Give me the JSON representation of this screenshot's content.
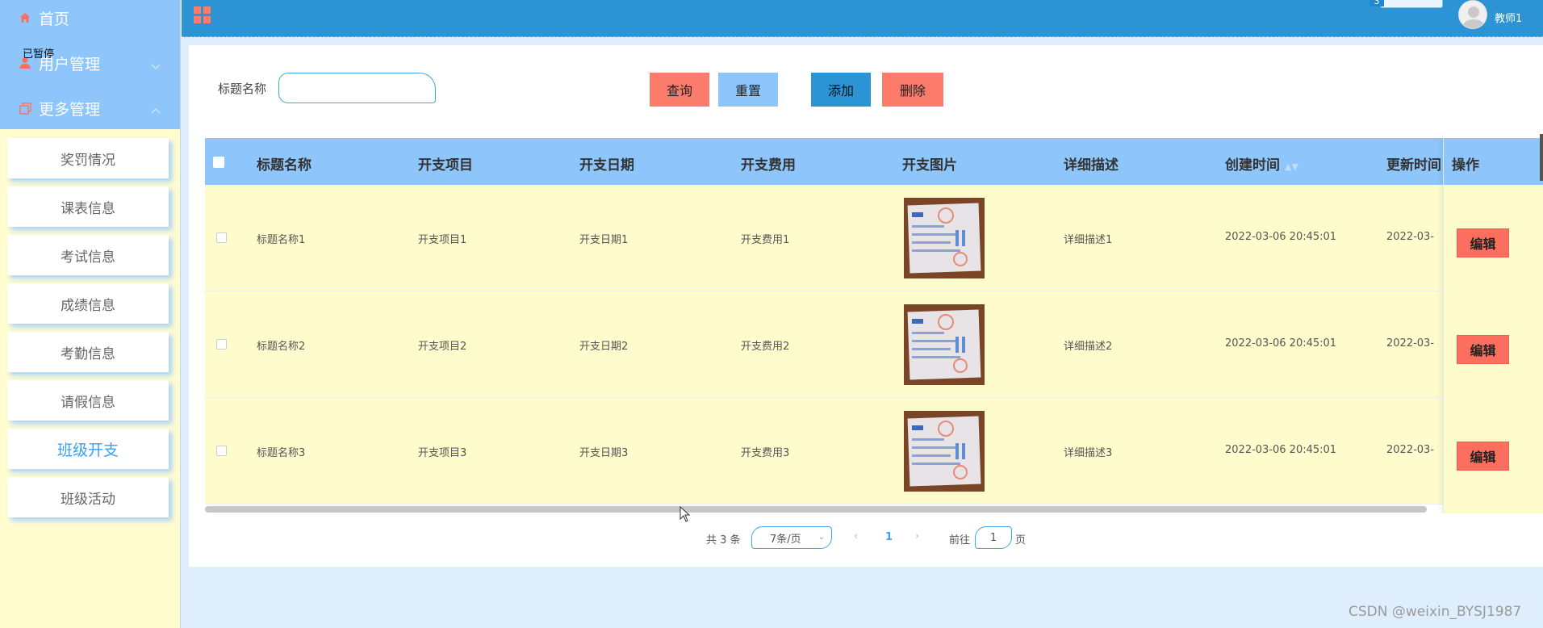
{
  "sidebar": {
    "menus": [
      {
        "label": "首页",
        "icon": "home-icon"
      },
      {
        "label": "用户管理",
        "icon": "user-icon"
      },
      {
        "label": "更多管理",
        "icon": "copy-icon"
      }
    ],
    "overlay_text": "已暂停",
    "sub_items": [
      {
        "label": "奖罚情况"
      },
      {
        "label": "课表信息"
      },
      {
        "label": "考试信息"
      },
      {
        "label": "成绩信息"
      },
      {
        "label": "考勤信息"
      },
      {
        "label": "请假信息"
      },
      {
        "label": "班级开支"
      },
      {
        "label": "班级活动"
      }
    ],
    "active_item": "班级开支"
  },
  "header": {
    "menu_icon": "grid-icon",
    "username": "教师1",
    "badge_number": "3"
  },
  "search": {
    "label": "标题名称",
    "value": "",
    "placeholder": ""
  },
  "toolbar": {
    "query_label": "查询",
    "reset_label": "重置",
    "add_label": "添加",
    "delete_label": "删除"
  },
  "table": {
    "columns": [
      "标题名称",
      "开支项目",
      "开支日期",
      "开支费用",
      "开支图片",
      "详细描述",
      "创建时间",
      "更新时间",
      "操作"
    ],
    "rows": [
      {
        "title": "标题名称1",
        "item": "开支项目1",
        "date": "开支日期1",
        "cost": "开支费用1",
        "desc": "详细描述1",
        "created": "2022-03-06 20:45:01",
        "updated": "2022-03-",
        "action": "编辑"
      },
      {
        "title": "标题名称2",
        "item": "开支项目2",
        "date": "开支日期2",
        "cost": "开支费用2",
        "desc": "详细描述2",
        "created": "2022-03-06 20:45:01",
        "updated": "2022-03-",
        "action": "编辑"
      },
      {
        "title": "标题名称3",
        "item": "开支项目3",
        "date": "开支日期3",
        "cost": "开支费用3",
        "desc": "详细描述3",
        "created": "2022-03-06 20:45:01",
        "updated": "2022-03-",
        "action": "编辑"
      }
    ]
  },
  "pagination": {
    "total": "共 3 条",
    "page_size": "7条/页",
    "current": "1",
    "goto_label": "前往",
    "goto_value": "1",
    "page_suffix": "页"
  },
  "watermark": "CSDN @weixin_BYSJ1987",
  "colors": {
    "header_blue": "#2c93d5",
    "light_blue": "#8ec5fb",
    "row_yellow": "#fefbcc",
    "salmon": "#fc7c6c",
    "active_text": "#3a9ff5"
  }
}
